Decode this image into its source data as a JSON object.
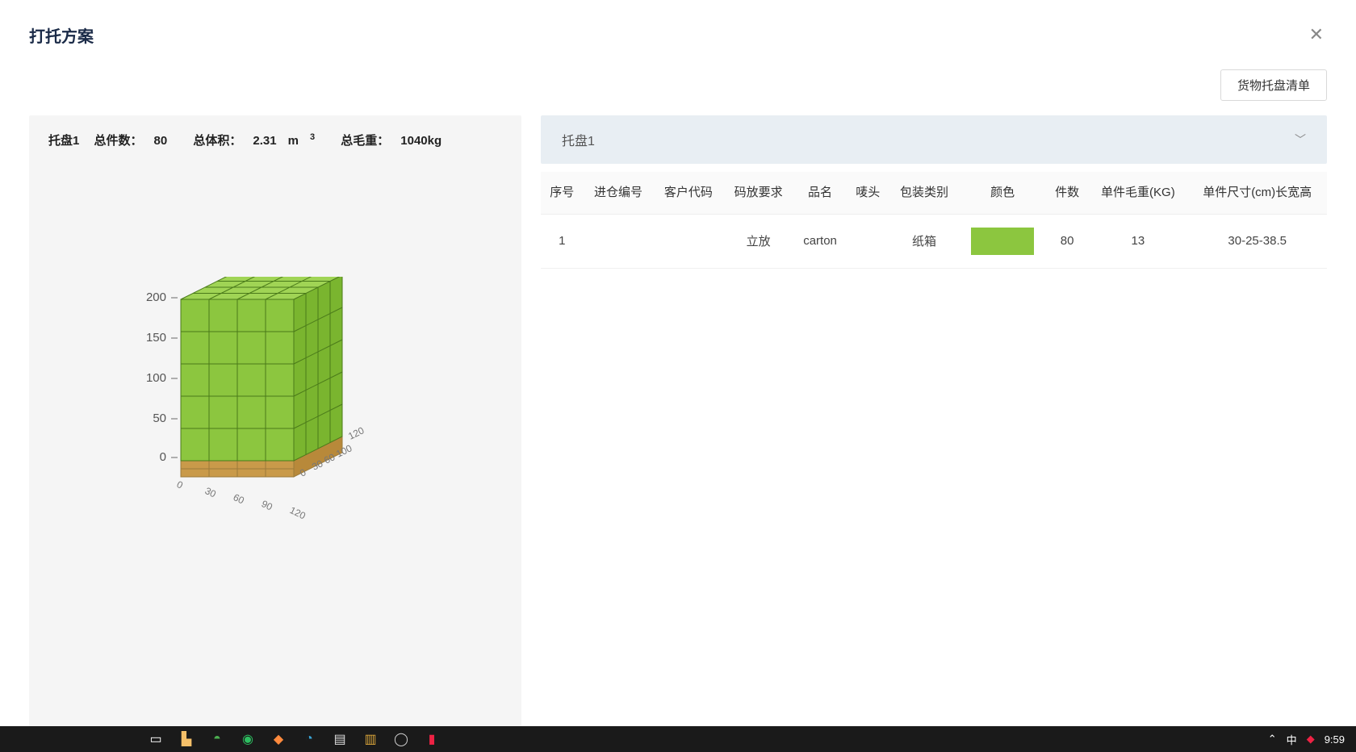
{
  "header": {
    "title": "打托方案"
  },
  "toolbar": {
    "list_button": "货物托盘清单"
  },
  "summary": {
    "pallet_label": "托盘1",
    "total_pieces_label": "总件数：",
    "total_pieces": "80",
    "total_volume_label": "总体积：",
    "total_volume_value": "2.31",
    "total_volume_unit_prefix": "m",
    "total_volume_unit_exp": "3",
    "total_gross_label": "总毛重：",
    "total_gross": "1040kg"
  },
  "viz": {
    "z_ticks": [
      "200",
      "150",
      "100",
      "50",
      "0"
    ],
    "x_ticks": [
      "0",
      "30",
      "60",
      "90",
      "120"
    ],
    "y_ticks": [
      "0",
      "30",
      "60",
      "90",
      "120"
    ]
  },
  "accordion": {
    "pallet_label": "托盘1"
  },
  "table": {
    "headers": {
      "seq": "序号",
      "inbound": "进仓编号",
      "customer": "客户代码",
      "stacking": "码放要求",
      "name": "品名",
      "mark": "唛头",
      "package": "包装类别",
      "color": "颜色",
      "pieces": "件数",
      "unit_weight": "单件毛重(KG)",
      "unit_dim": "单件尺寸(cm)长宽高"
    },
    "rows": [
      {
        "seq": "1",
        "inbound": "",
        "customer": "",
        "stacking": "立放",
        "name": "carton",
        "mark": "",
        "package": "纸箱",
        "color": "#8cc63f",
        "pieces": "80",
        "unit_weight": "13",
        "unit_dim": "30-25-38.5"
      }
    ]
  },
  "taskbar": {
    "time": "9:59"
  },
  "chart_data": {
    "type": "3d-pallet-stack",
    "pallet_size_cm": [
      120,
      100
    ],
    "box_size_cm": [
      30,
      25,
      38.5
    ],
    "layout": {
      "cols_x": 4,
      "cols_y": 4,
      "layers_z": 5
    },
    "total_boxes": 80,
    "z_axis": {
      "range": [
        0,
        200
      ],
      "ticks": [
        0,
        50,
        100,
        150,
        200
      ]
    },
    "x_axis": {
      "range": [
        0,
        120
      ],
      "ticks": [
        0,
        30,
        60,
        90,
        120
      ]
    },
    "y_axis": {
      "range": [
        0,
        120
      ],
      "ticks": [
        0,
        30,
        60,
        90,
        120
      ]
    },
    "box_color": "#8cc63f",
    "pallet_color": "#d4a84a"
  }
}
